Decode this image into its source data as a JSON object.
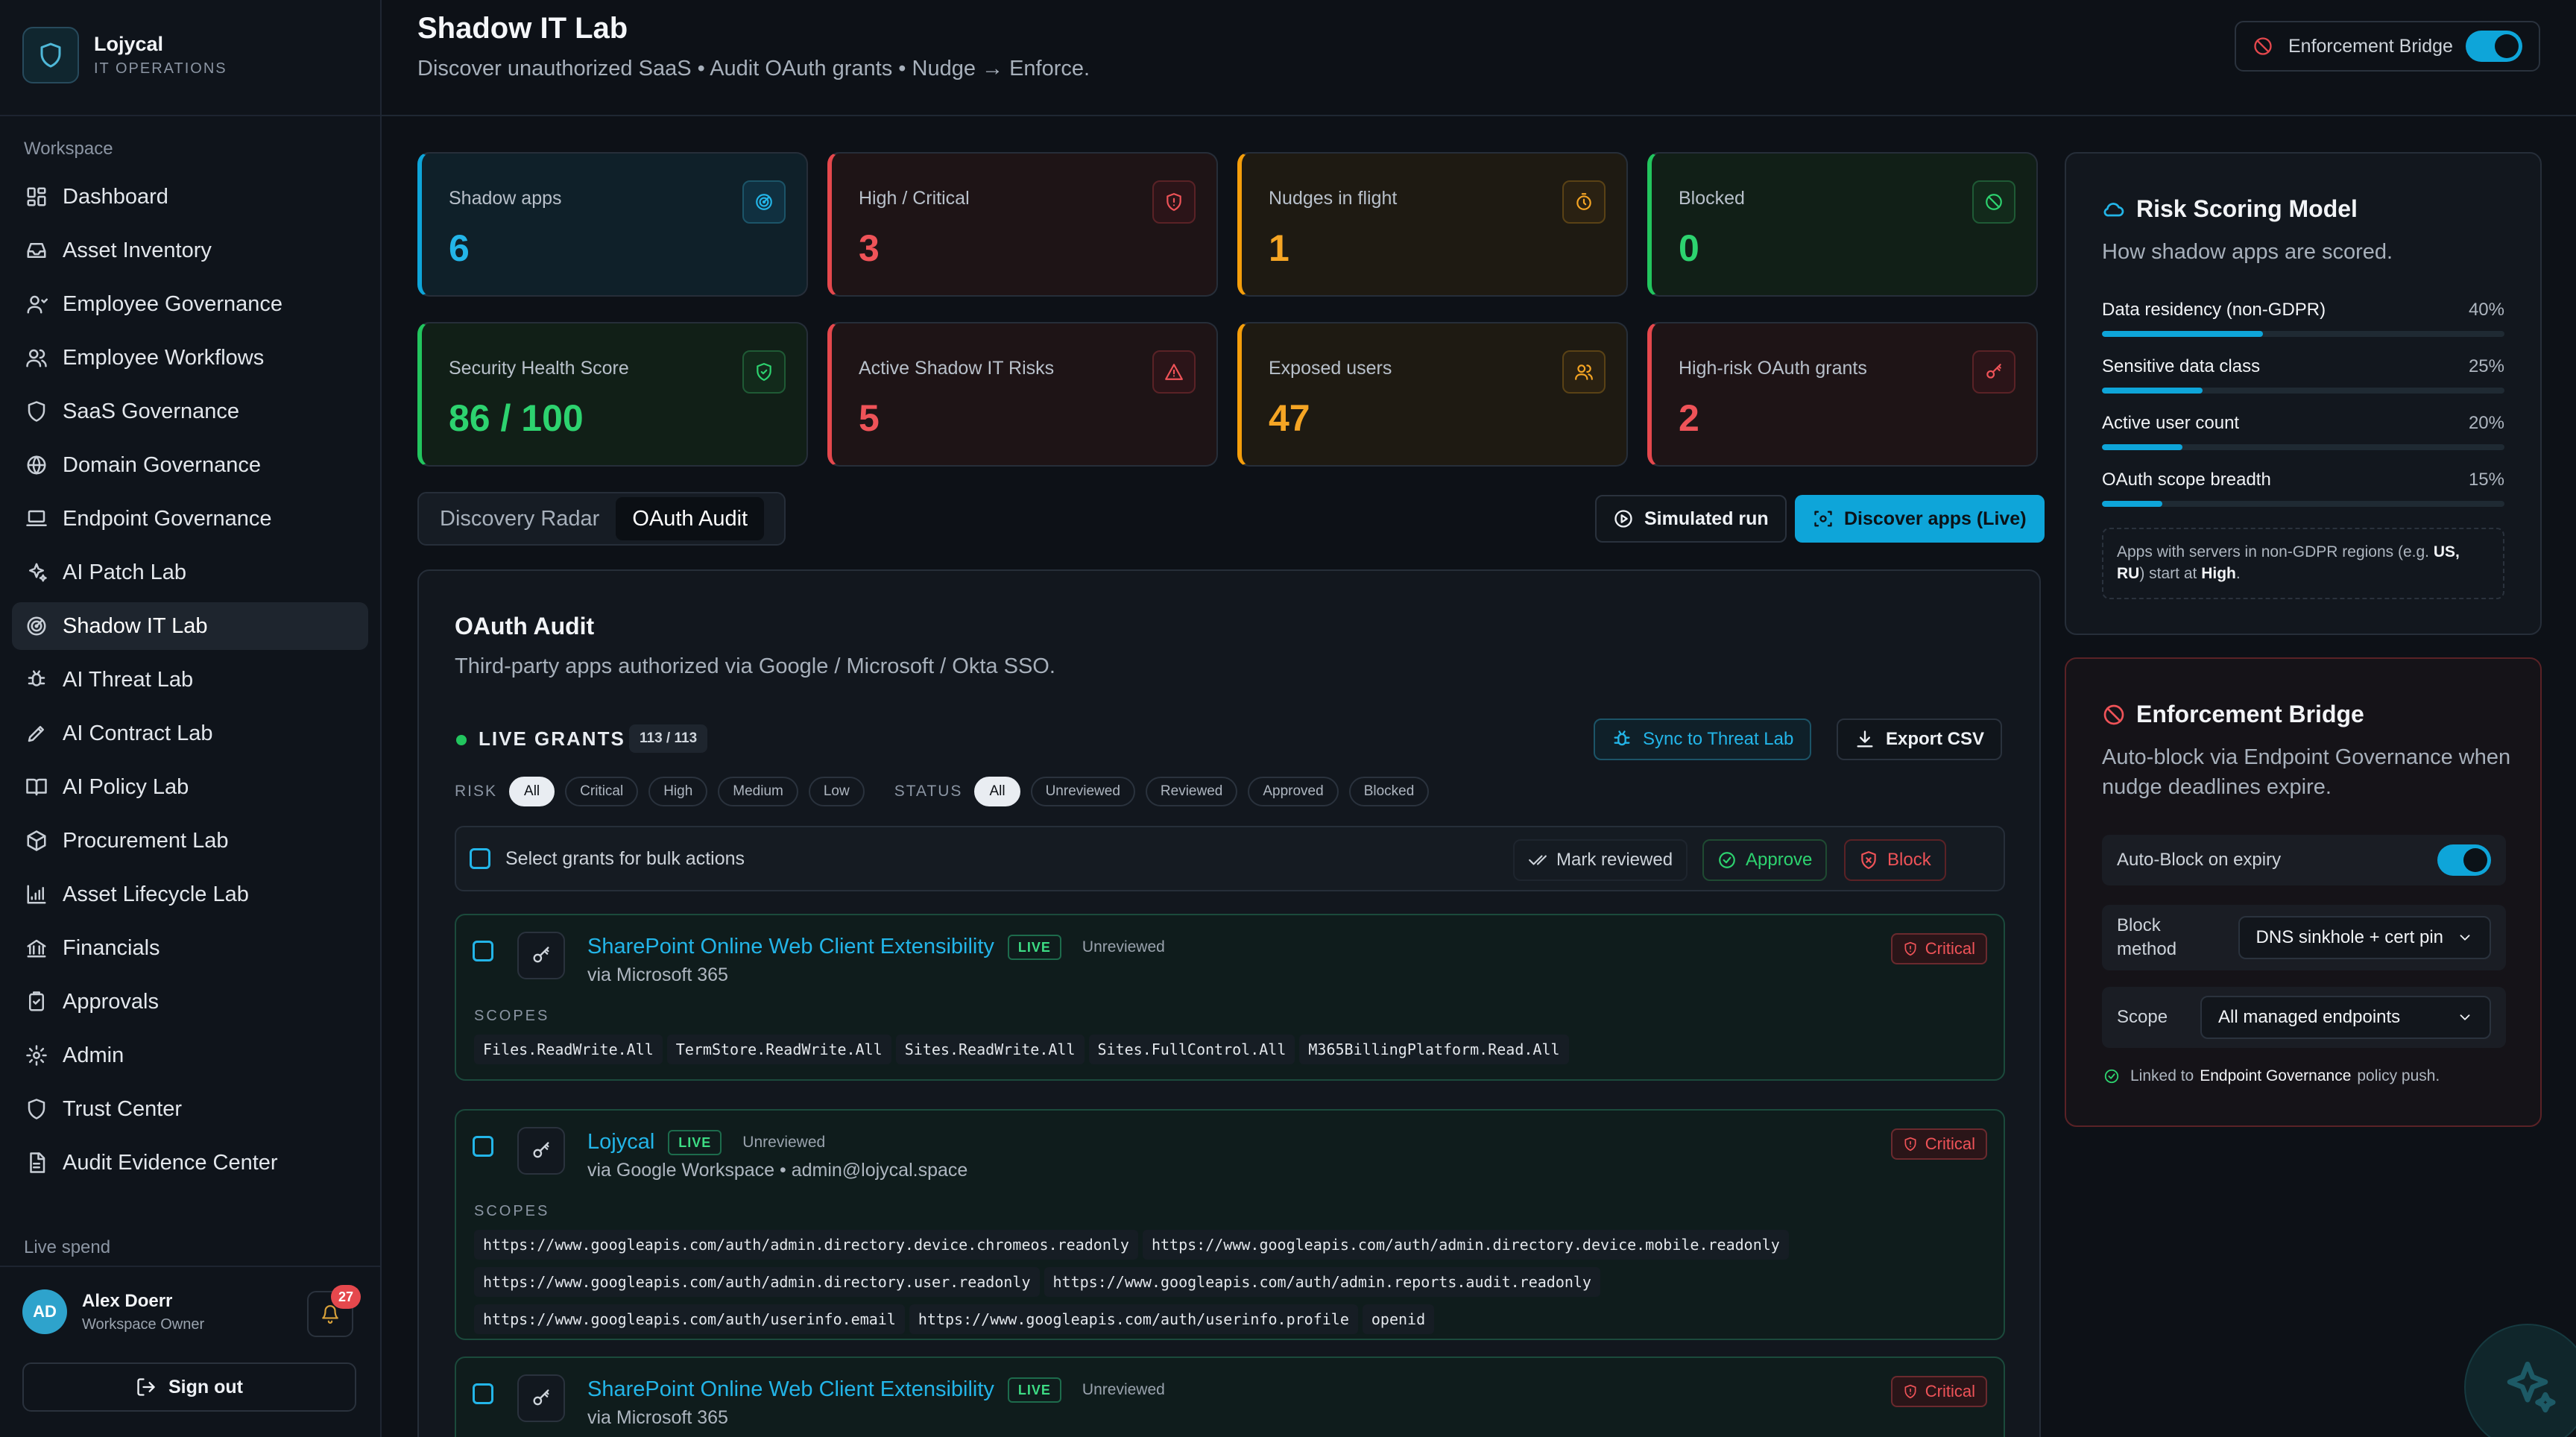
{
  "brand": {
    "name": "Lojycal",
    "subtitle": "IT OPERATIONS"
  },
  "sidebar": {
    "section_label": "Workspace",
    "items": [
      {
        "label": "Dashboard",
        "icon": "dashboard-icon"
      },
      {
        "label": "Asset Inventory",
        "icon": "inbox-icon"
      },
      {
        "label": "Employee Governance",
        "icon": "user-icon"
      },
      {
        "label": "Employee Workflows",
        "icon": "users-icon"
      },
      {
        "label": "SaaS Governance",
        "icon": "shield-icon"
      },
      {
        "label": "Domain Governance",
        "icon": "globe-icon"
      },
      {
        "label": "Endpoint Governance",
        "icon": "laptop-icon"
      },
      {
        "label": "AI Patch Lab",
        "icon": "sparkles-icon"
      },
      {
        "label": "Shadow IT Lab",
        "icon": "radar-icon",
        "active": true
      },
      {
        "label": "AI Threat Lab",
        "icon": "bug-icon"
      },
      {
        "label": "AI Contract Lab",
        "icon": "pen-icon"
      },
      {
        "label": "AI Policy Lab",
        "icon": "book-icon"
      },
      {
        "label": "Procurement Lab",
        "icon": "package-icon"
      },
      {
        "label": "Asset Lifecycle Lab",
        "icon": "chart-icon"
      },
      {
        "label": "Financials",
        "icon": "bank-icon"
      },
      {
        "label": "Approvals",
        "icon": "clipboard-icon"
      },
      {
        "label": "Admin",
        "icon": "gear-icon"
      },
      {
        "label": "Trust Center",
        "icon": "shield-icon"
      },
      {
        "label": "Audit Evidence Center",
        "icon": "file-icon"
      }
    ],
    "live_spend_label": "Live spend",
    "user": {
      "initials": "AD",
      "name": "Alex Doerr",
      "role": "Workspace Owner",
      "notifications": "27"
    },
    "sign_out": "Sign out"
  },
  "header": {
    "title": "Shadow IT Lab",
    "subtitle": "Discover unauthorized SaaS • Audit OAuth grants • Nudge → Enforce.",
    "enforcement_label": "Enforcement Bridge",
    "enforcement_on": true
  },
  "stats": [
    {
      "label": "Shadow apps",
      "value": "6",
      "color": "cyan",
      "icon": "radar-icon"
    },
    {
      "label": "High / Critical",
      "value": "3",
      "color": "red",
      "icon": "shield-alert-icon"
    },
    {
      "label": "Nudges in flight",
      "value": "1",
      "color": "amber",
      "icon": "timer-icon"
    },
    {
      "label": "Blocked",
      "value": "0",
      "color": "green",
      "icon": "ban-icon"
    },
    {
      "label": "Security Health Score",
      "value": "86 / 100",
      "color": "green",
      "icon": "shield-check-icon"
    },
    {
      "label": "Active Shadow IT Risks",
      "value": "5",
      "color": "red",
      "icon": "warning-icon"
    },
    {
      "label": "Exposed users",
      "value": "47",
      "color": "amber",
      "icon": "users-icon"
    },
    {
      "label": "High-risk OAuth grants",
      "value": "2",
      "color": "red",
      "icon": "key-icon"
    }
  ],
  "tabs": {
    "discovery": "Discovery Radar",
    "oauth": "OAuth Audit",
    "active": "OAuth Audit"
  },
  "actions": {
    "simulated": "Simulated run",
    "discover": "Discover apps (Live)"
  },
  "oauth": {
    "title": "OAuth Audit",
    "subtitle": "Third-party apps authorized via Google / Microsoft / Okta SSO.",
    "live_label": "LIVE GRANTS",
    "live_count": "113 / 113",
    "sync": "Sync to Threat Lab",
    "export": "Export CSV",
    "risk_label": "RISK",
    "risk_filters": [
      "All",
      "Critical",
      "High",
      "Medium",
      "Low"
    ],
    "status_label": "STATUS",
    "status_filters": [
      "All",
      "Unreviewed",
      "Reviewed",
      "Approved",
      "Blocked"
    ],
    "bulk_text": "Select grants for bulk actions",
    "mark_reviewed": "Mark reviewed",
    "approve": "Approve",
    "block": "Block",
    "scopes_label": "SCOPES",
    "grants": [
      {
        "name": "SharePoint Online Web Client Extensibility",
        "badge": "LIVE",
        "status": "Unreviewed",
        "via": "via Microsoft 365",
        "risk": "Critical",
        "scopes": [
          "Files.ReadWrite.All",
          "TermStore.ReadWrite.All",
          "Sites.ReadWrite.All",
          "Sites.FullControl.All",
          "M365BillingPlatform.Read.All"
        ]
      },
      {
        "name": "Lojycal",
        "badge": "LIVE",
        "status": "Unreviewed",
        "via": "via Google Workspace • admin@lojycal.space",
        "risk": "Critical",
        "scopes": [
          "https://www.googleapis.com/auth/admin.directory.device.chromeos.readonly",
          "https://www.googleapis.com/auth/admin.directory.device.mobile.readonly",
          "https://www.googleapis.com/auth/admin.directory.user.readonly",
          "https://www.googleapis.com/auth/admin.reports.audit.readonly",
          "https://www.googleapis.com/auth/userinfo.email",
          "https://www.googleapis.com/auth/userinfo.profile",
          "openid"
        ]
      },
      {
        "name": "SharePoint Online Web Client Extensibility",
        "badge": "LIVE",
        "status": "Unreviewed",
        "via": "via Microsoft 365",
        "risk": "Critical",
        "scopes": []
      }
    ]
  },
  "risk_model": {
    "title": "Risk Scoring Model",
    "subtitle": "How shadow apps are scored.",
    "factors": [
      {
        "label": "Data residency (non-GDPR)",
        "weight": "40%",
        "pct": 40
      },
      {
        "label": "Sensitive data class",
        "weight": "25%",
        "pct": 25
      },
      {
        "label": "Active user count",
        "weight": "20%",
        "pct": 20
      },
      {
        "label": "OAuth scope breadth",
        "weight": "15%",
        "pct": 15
      }
    ],
    "note_prefix": "Apps with servers in non-GDPR regions (e.g.",
    "note_regions": "US, RU",
    "note_mid": ") start at",
    "note_level": "High",
    "note_end": "."
  },
  "bridge": {
    "title": "Enforcement Bridge",
    "subtitle": "Auto-block via Endpoint Governance when nudge deadlines expire.",
    "auto_block_label": "Auto-Block on expiry",
    "auto_block_on": true,
    "method_label": "Block method",
    "method_value": "DNS sinkhole + cert pin",
    "scope_label": "Scope",
    "scope_value": "All managed endpoints",
    "linked_prefix": "Linked to",
    "linked_target": "Endpoint Governance",
    "linked_suffix": "policy push."
  }
}
